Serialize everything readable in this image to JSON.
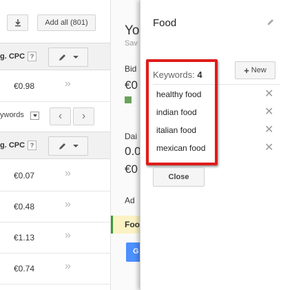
{
  "toolbar": {
    "download_icon": "download-icon",
    "add_all_label": "Add all (801)"
  },
  "table": {
    "column_header": "g. CPC",
    "help_mark": "?",
    "keywords_label": "ywords",
    "top_row_value": "€0.98",
    "rows": [
      {
        "value": "€0.07"
      },
      {
        "value": "€0.48"
      },
      {
        "value": "€1.13"
      },
      {
        "value": "€0.74"
      }
    ],
    "pager_prev": "‹",
    "pager_next": "›",
    "row_action": "»"
  },
  "behind_panel": {
    "title": "Yo",
    "subtitle": "Sav",
    "bid_label": "Bid",
    "bid_value": "€0",
    "daily_label": "Dai",
    "daily_value1": "0.0",
    "daily_value2": "€0",
    "ad_label": "Ad",
    "highlight_label": "Foo",
    "blue_button_label": "G"
  },
  "popup": {
    "title": "Food",
    "keywords_label": "Keywords:",
    "keywords_count": "4",
    "new_button_label": "New",
    "keywords": [
      "healthy food",
      "indian food",
      "italian food",
      "mexican food"
    ],
    "remove_glyph": "✕",
    "close_button_label": "Close"
  },
  "colors": {
    "highlight_border": "#e01b1b",
    "accent_blue": "#4d90fe",
    "highlight_bg": "#fbf3c4"
  }
}
